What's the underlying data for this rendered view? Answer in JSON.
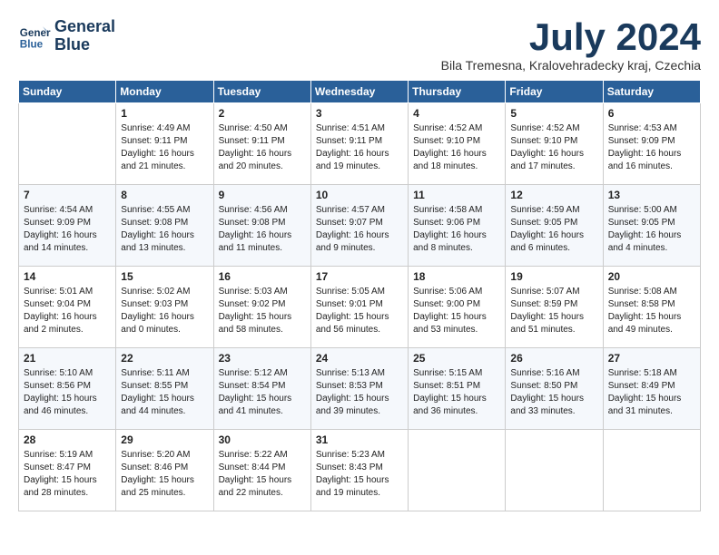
{
  "header": {
    "logo_line1": "General",
    "logo_line2": "Blue",
    "month": "July 2024",
    "location": "Bila Tremesna, Kralovehradecky kraj, Czechia"
  },
  "days_of_week": [
    "Sunday",
    "Monday",
    "Tuesday",
    "Wednesday",
    "Thursday",
    "Friday",
    "Saturday"
  ],
  "weeks": [
    [
      {
        "day": "",
        "lines": []
      },
      {
        "day": "1",
        "lines": [
          "Sunrise: 4:49 AM",
          "Sunset: 9:11 PM",
          "Daylight: 16 hours",
          "and 21 minutes."
        ]
      },
      {
        "day": "2",
        "lines": [
          "Sunrise: 4:50 AM",
          "Sunset: 9:11 PM",
          "Daylight: 16 hours",
          "and 20 minutes."
        ]
      },
      {
        "day": "3",
        "lines": [
          "Sunrise: 4:51 AM",
          "Sunset: 9:11 PM",
          "Daylight: 16 hours",
          "and 19 minutes."
        ]
      },
      {
        "day": "4",
        "lines": [
          "Sunrise: 4:52 AM",
          "Sunset: 9:10 PM",
          "Daylight: 16 hours",
          "and 18 minutes."
        ]
      },
      {
        "day": "5",
        "lines": [
          "Sunrise: 4:52 AM",
          "Sunset: 9:10 PM",
          "Daylight: 16 hours",
          "and 17 minutes."
        ]
      },
      {
        "day": "6",
        "lines": [
          "Sunrise: 4:53 AM",
          "Sunset: 9:09 PM",
          "Daylight: 16 hours",
          "and 16 minutes."
        ]
      }
    ],
    [
      {
        "day": "7",
        "lines": [
          "Sunrise: 4:54 AM",
          "Sunset: 9:09 PM",
          "Daylight: 16 hours",
          "and 14 minutes."
        ]
      },
      {
        "day": "8",
        "lines": [
          "Sunrise: 4:55 AM",
          "Sunset: 9:08 PM",
          "Daylight: 16 hours",
          "and 13 minutes."
        ]
      },
      {
        "day": "9",
        "lines": [
          "Sunrise: 4:56 AM",
          "Sunset: 9:08 PM",
          "Daylight: 16 hours",
          "and 11 minutes."
        ]
      },
      {
        "day": "10",
        "lines": [
          "Sunrise: 4:57 AM",
          "Sunset: 9:07 PM",
          "Daylight: 16 hours",
          "and 9 minutes."
        ]
      },
      {
        "day": "11",
        "lines": [
          "Sunrise: 4:58 AM",
          "Sunset: 9:06 PM",
          "Daylight: 16 hours",
          "and 8 minutes."
        ]
      },
      {
        "day": "12",
        "lines": [
          "Sunrise: 4:59 AM",
          "Sunset: 9:05 PM",
          "Daylight: 16 hours",
          "and 6 minutes."
        ]
      },
      {
        "day": "13",
        "lines": [
          "Sunrise: 5:00 AM",
          "Sunset: 9:05 PM",
          "Daylight: 16 hours",
          "and 4 minutes."
        ]
      }
    ],
    [
      {
        "day": "14",
        "lines": [
          "Sunrise: 5:01 AM",
          "Sunset: 9:04 PM",
          "Daylight: 16 hours",
          "and 2 minutes."
        ]
      },
      {
        "day": "15",
        "lines": [
          "Sunrise: 5:02 AM",
          "Sunset: 9:03 PM",
          "Daylight: 16 hours",
          "and 0 minutes."
        ]
      },
      {
        "day": "16",
        "lines": [
          "Sunrise: 5:03 AM",
          "Sunset: 9:02 PM",
          "Daylight: 15 hours",
          "and 58 minutes."
        ]
      },
      {
        "day": "17",
        "lines": [
          "Sunrise: 5:05 AM",
          "Sunset: 9:01 PM",
          "Daylight: 15 hours",
          "and 56 minutes."
        ]
      },
      {
        "day": "18",
        "lines": [
          "Sunrise: 5:06 AM",
          "Sunset: 9:00 PM",
          "Daylight: 15 hours",
          "and 53 minutes."
        ]
      },
      {
        "day": "19",
        "lines": [
          "Sunrise: 5:07 AM",
          "Sunset: 8:59 PM",
          "Daylight: 15 hours",
          "and 51 minutes."
        ]
      },
      {
        "day": "20",
        "lines": [
          "Sunrise: 5:08 AM",
          "Sunset: 8:58 PM",
          "Daylight: 15 hours",
          "and 49 minutes."
        ]
      }
    ],
    [
      {
        "day": "21",
        "lines": [
          "Sunrise: 5:10 AM",
          "Sunset: 8:56 PM",
          "Daylight: 15 hours",
          "and 46 minutes."
        ]
      },
      {
        "day": "22",
        "lines": [
          "Sunrise: 5:11 AM",
          "Sunset: 8:55 PM",
          "Daylight: 15 hours",
          "and 44 minutes."
        ]
      },
      {
        "day": "23",
        "lines": [
          "Sunrise: 5:12 AM",
          "Sunset: 8:54 PM",
          "Daylight: 15 hours",
          "and 41 minutes."
        ]
      },
      {
        "day": "24",
        "lines": [
          "Sunrise: 5:13 AM",
          "Sunset: 8:53 PM",
          "Daylight: 15 hours",
          "and 39 minutes."
        ]
      },
      {
        "day": "25",
        "lines": [
          "Sunrise: 5:15 AM",
          "Sunset: 8:51 PM",
          "Daylight: 15 hours",
          "and 36 minutes."
        ]
      },
      {
        "day": "26",
        "lines": [
          "Sunrise: 5:16 AM",
          "Sunset: 8:50 PM",
          "Daylight: 15 hours",
          "and 33 minutes."
        ]
      },
      {
        "day": "27",
        "lines": [
          "Sunrise: 5:18 AM",
          "Sunset: 8:49 PM",
          "Daylight: 15 hours",
          "and 31 minutes."
        ]
      }
    ],
    [
      {
        "day": "28",
        "lines": [
          "Sunrise: 5:19 AM",
          "Sunset: 8:47 PM",
          "Daylight: 15 hours",
          "and 28 minutes."
        ]
      },
      {
        "day": "29",
        "lines": [
          "Sunrise: 5:20 AM",
          "Sunset: 8:46 PM",
          "Daylight: 15 hours",
          "and 25 minutes."
        ]
      },
      {
        "day": "30",
        "lines": [
          "Sunrise: 5:22 AM",
          "Sunset: 8:44 PM",
          "Daylight: 15 hours",
          "and 22 minutes."
        ]
      },
      {
        "day": "31",
        "lines": [
          "Sunrise: 5:23 AM",
          "Sunset: 8:43 PM",
          "Daylight: 15 hours",
          "and 19 minutes."
        ]
      },
      {
        "day": "",
        "lines": []
      },
      {
        "day": "",
        "lines": []
      },
      {
        "day": "",
        "lines": []
      }
    ]
  ]
}
